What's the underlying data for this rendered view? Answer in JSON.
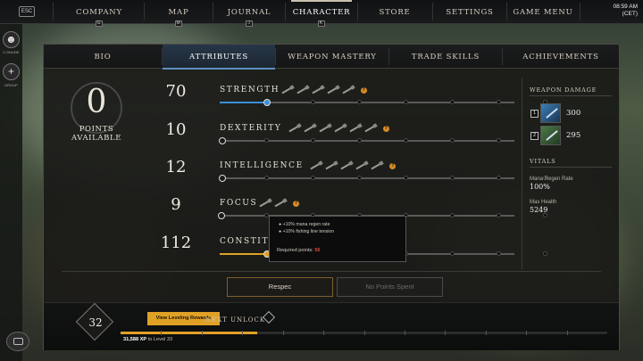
{
  "top_nav": {
    "esc_label": "ESC",
    "tabs": [
      {
        "label": "COMPANY",
        "key": "G"
      },
      {
        "label": "MAP",
        "key": "M"
      },
      {
        "label": "JOURNAL",
        "key": "J"
      },
      {
        "label": "CHARACTER",
        "key": "K",
        "active": true
      },
      {
        "label": "STORE",
        "key": ""
      },
      {
        "label": "SETTINGS",
        "key": ""
      },
      {
        "label": "GAME MENU",
        "key": ""
      }
    ],
    "time": "08:59 AM",
    "timezone": "(CET)"
  },
  "left_rail": {
    "online_label": "0 ONLINE",
    "group_label": "GROUP",
    "add_icon": "+",
    "chat_icon": "chat-icon"
  },
  "sub_tabs": [
    {
      "label": "BIO"
    },
    {
      "label": "ATTRIBUTES",
      "active": true
    },
    {
      "label": "WEAPON MASTERY"
    },
    {
      "label": "TRADE SKILLS"
    },
    {
      "label": "ACHIEVEMENTS"
    }
  ],
  "points": {
    "value": "0",
    "label": "POINTS AVAILABLE"
  },
  "attributes": [
    {
      "name": "STRENGTH",
      "value": "70",
      "progress": 0.16,
      "color": "#3a8fd8",
      "weapons": 5
    },
    {
      "name": "DEXTERITY",
      "value": "10",
      "progress": 0.01,
      "color": "#8a8880",
      "weapons": 6
    },
    {
      "name": "INTELLIGENCE",
      "value": "12",
      "progress": 0.01,
      "color": "#8a8880",
      "weapons": 5
    },
    {
      "name": "FOCUS",
      "value": "9",
      "progress": 0.0,
      "color": "#8a8880",
      "weapons": 2
    },
    {
      "name": "CONSTIT",
      "value": "112",
      "progress": 0.16,
      "color": "#e0a126",
      "weapons": 0
    }
  ],
  "tooltip": {
    "line1": "+10% mana regen rate",
    "line2": "+10% fishing line tension",
    "req_label": "Required points:",
    "req_value": "50"
  },
  "weapon_damage": {
    "title": "WEAPON DAMAGE",
    "slots": [
      {
        "num": "1",
        "value": "300"
      },
      {
        "num": "2",
        "value": "295"
      }
    ]
  },
  "vitals": {
    "title": "VITALS",
    "mana_label": "Mana Regen Rate",
    "mana_value": "100%",
    "health_label": "Max Health",
    "health_value": "5249"
  },
  "buttons": {
    "respec": "Respec",
    "no_points": "No Points Spent"
  },
  "level": {
    "value": "32",
    "view_rewards": "View Leveling Rewards",
    "next_unlock": "NEXT UNLOCK",
    "xp_amount": "31,588 XP",
    "xp_suffix": "to Level 33",
    "xp_progress": 0.28
  },
  "colors": {
    "accent": "#e0a126",
    "blue": "#3a8fd8",
    "required": "#e74a3c"
  }
}
